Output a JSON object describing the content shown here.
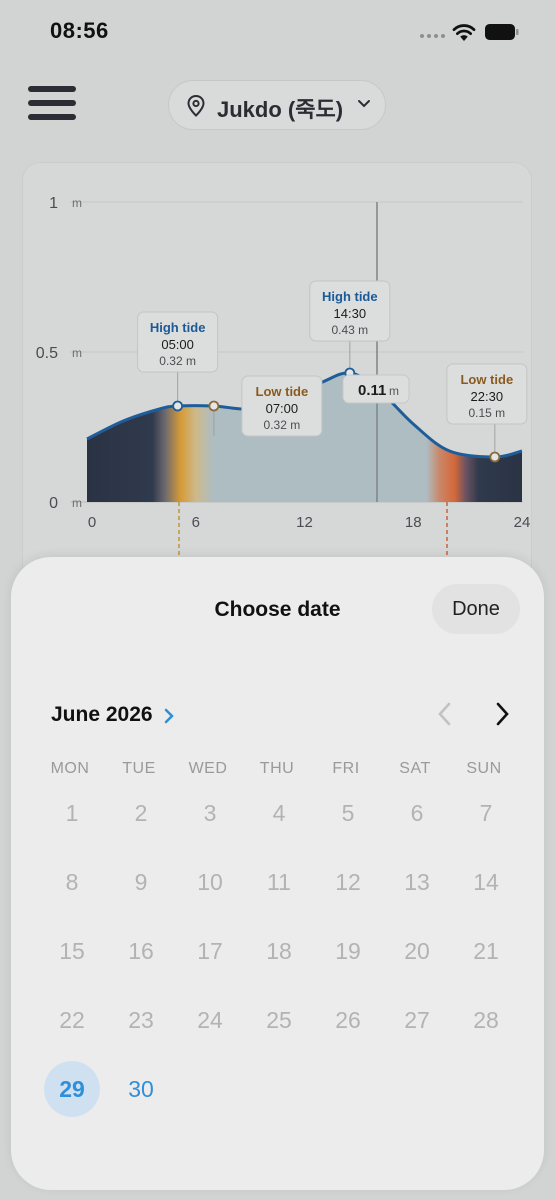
{
  "status_bar": {
    "time": "08:56"
  },
  "header": {
    "location": "Jukdo (죽도)"
  },
  "chart_data": {
    "type": "area",
    "y_tick_labels": [
      "1",
      "0.5",
      "0"
    ],
    "y_unit": "m",
    "x_ticks": [
      "0",
      "6",
      "12",
      "18",
      "24"
    ],
    "ylim": [
      0,
      1
    ],
    "xlim": [
      0,
      24
    ],
    "series": [
      {
        "x": [
          0,
          2,
          4,
          5,
          7,
          9,
          11,
          13,
          14.5,
          16,
          18,
          20,
          22.5,
          24
        ],
        "y": [
          0.21,
          0.27,
          0.31,
          0.32,
          0.32,
          0.31,
          0.34,
          0.4,
          0.43,
          0.38,
          0.26,
          0.17,
          0.15,
          0.17
        ]
      }
    ],
    "current": {
      "x": 16,
      "value": "0.11",
      "unit": "m"
    },
    "events": [
      {
        "label": "High tide",
        "time": "05:00",
        "height": "0.32 m",
        "x": 5,
        "y": 0.32,
        "kind": "high"
      },
      {
        "label": "Low tide",
        "time": "07:00",
        "height": "0.32 m",
        "x": 7,
        "y": 0.32,
        "kind": "low"
      },
      {
        "label": "High tide",
        "time": "14:30",
        "height": "0.43 m",
        "x": 14.5,
        "y": 0.43,
        "kind": "high"
      },
      {
        "label": "Low tide",
        "time": "22:30",
        "height": "0.15 m",
        "x": 22.5,
        "y": 0.15,
        "kind": "low"
      }
    ],
    "colors": {
      "high": "#1b5a96",
      "low": "#8a5a1e",
      "line": "#1f5d9a",
      "fill_night": "#2a3344",
      "fill_day": "#aebdc2"
    }
  },
  "sheet": {
    "title": "Choose date",
    "done_label": "Done",
    "month": "June 2026",
    "weekdays": [
      "MON",
      "TUE",
      "WED",
      "THU",
      "FRI",
      "SAT",
      "SUN"
    ],
    "days": [
      [
        "1",
        "2",
        "3",
        "4",
        "5",
        "6",
        "7"
      ],
      [
        "8",
        "9",
        "10",
        "11",
        "12",
        "13",
        "14"
      ],
      [
        "15",
        "16",
        "17",
        "18",
        "19",
        "20",
        "21"
      ],
      [
        "22",
        "23",
        "24",
        "25",
        "26",
        "27",
        "28"
      ],
      [
        "29",
        "30"
      ]
    ],
    "selected_day": "29",
    "enabled_days": [
      "29",
      "30"
    ]
  }
}
